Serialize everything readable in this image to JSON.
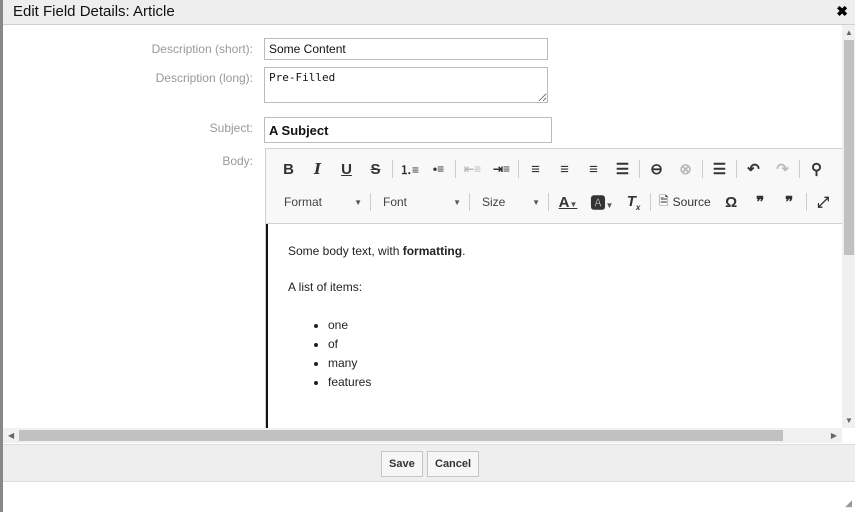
{
  "dialog": {
    "title": "Edit Field Details: Article",
    "close_icon": "close-icon"
  },
  "form": {
    "desc_short_label": "Description (short):",
    "desc_short_value": "Some Content",
    "desc_long_label": "Description (long):",
    "desc_long_value": "Pre-Filled",
    "subject_label": "Subject:",
    "subject_value": "A Subject",
    "body_label": "Body:"
  },
  "toolbar": {
    "format": "Format",
    "font": "Font",
    "size": "Size",
    "source": "Source"
  },
  "body": {
    "line1_prefix": "Some body text, with ",
    "line1_bold": "formatting",
    "line1_suffix": ".",
    "line2": "A list of items:",
    "items": [
      "one",
      "of",
      "many",
      "features"
    ]
  },
  "footer": {
    "save": "Save",
    "cancel": "Cancel"
  }
}
